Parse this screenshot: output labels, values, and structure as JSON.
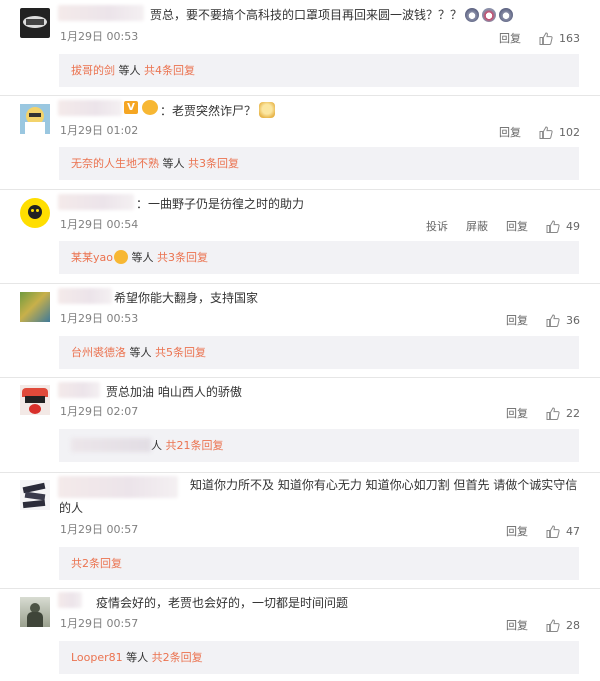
{
  "comments": [
    {
      "text": "贾总，要不要搞个高科技的口罩项目再回来圆一波钱？？？",
      "date": "1月29日 00:53",
      "reply_label": "回复",
      "likes": "163",
      "replies": {
        "user": "拔哥的剑",
        "middle": " 等人 ",
        "count": "共4条回复"
      }
    },
    {
      "text": "：老贾突然诈尸？",
      "date": "1月29日 01:02",
      "reply_label": "回复",
      "likes": "102",
      "replies": {
        "user": "无奈的人生地不熟",
        "middle": " 等人 ",
        "count": "共3条回复"
      }
    },
    {
      "text": "：一曲野子仍是彷徨之时的助力",
      "date": "1月29日 00:54",
      "report_label": "投诉",
      "block_label": "屏蔽",
      "reply_label": "回复",
      "likes": "49",
      "replies": {
        "user": "某某yao",
        "middle": " 等人 ",
        "count": "共3条回复"
      }
    },
    {
      "text": "希望你能大翻身，支持国家",
      "date": "1月29日 00:53",
      "reply_label": "回复",
      "likes": "36",
      "replies": {
        "user": "台州裘德洛",
        "middle": " 等人 ",
        "count": "共5条回复"
      }
    },
    {
      "text": "贾总加油 咱山西人的骄傲",
      "date": "1月29日 02:07",
      "reply_label": "回复",
      "likes": "22",
      "replies": {
        "user": "",
        "middle": "人 ",
        "count": "共21条回复"
      }
    },
    {
      "text": "知道你力所不及 知道你有心无力 知道你心如刀割 但首先 请做个诚实守信",
      "text2": "的人",
      "date": "1月29日 00:57",
      "reply_label": "回复",
      "likes": "47",
      "replies": {
        "user": "",
        "middle": "",
        "count": "共2条回复"
      }
    },
    {
      "text": "疫情会好的，老贾也会好的，一切都是时间问题",
      "date": "1月29日 00:57",
      "reply_label": "回复",
      "likes": "28",
      "replies": {
        "user": "Looper81",
        "middle": " 等人 ",
        "count": "共2条回复"
      }
    }
  ],
  "colors": {
    "accent": "#eb7350",
    "reply_bg": "#f2f2f5",
    "meta": "#808080"
  },
  "icons": {
    "like": "thumbs-up-icon"
  }
}
